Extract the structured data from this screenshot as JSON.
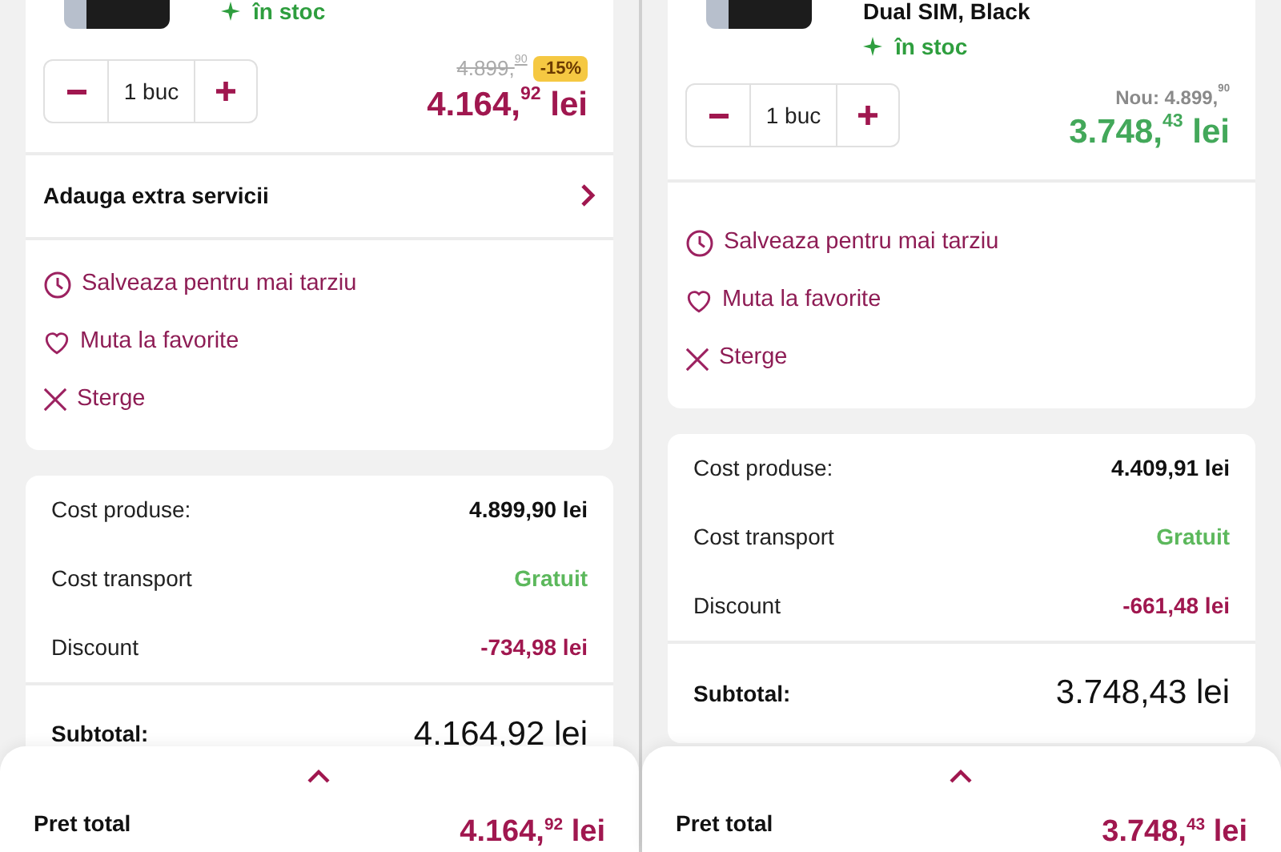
{
  "panels": [
    {
      "product": {
        "stock": "în stoc",
        "quantity": "1 buc",
        "reference_price": {
          "kind": "strikethrough",
          "text": "4.899,$^{90}$"
        },
        "badge": "-15%",
        "price": {
          "text": "4.164,$^{92}$ lei",
          "color": "#a0174f"
        }
      },
      "extra_services": "Adauga extra servicii",
      "actions": [
        {
          "kind": "clock",
          "label": "Salveaza pentru mai tarziu"
        },
        {
          "kind": "heart",
          "label": "Muta la favorite"
        },
        {
          "kind": "delete",
          "label": "Sterge"
        }
      ],
      "summary": {
        "rows": [
          {
            "label": "Cost produse:",
            "value": "4.899,90 lei",
            "kind": "default"
          },
          {
            "label": "Cost transport",
            "value": "Gratuit",
            "kind": "free"
          },
          {
            "label": "Discount",
            "value": "-734,98 lei",
            "kind": "discount"
          }
        ],
        "subtotal_label": "Subtotal:",
        "subtotal_value": "4.164,92 lei"
      },
      "footer": {
        "label": "Pret total",
        "price": "4.164,$^{92}$ lei"
      }
    },
    {
      "product": {
        "title": "Dual SIM, Black",
        "stock": "în stoc",
        "quantity": "1 buc",
        "reference_price": {
          "kind": "plain",
          "text": "Nou: 4.899,$^{90}$"
        },
        "price": {
          "text": "3.748,$^{43}$ lei",
          "color": "#43a85a"
        }
      },
      "actions": [
        {
          "kind": "clock",
          "label": "Salveaza pentru mai tarziu"
        },
        {
          "kind": "heart",
          "label": "Muta la favorite"
        },
        {
          "kind": "delete",
          "label": "Sterge"
        }
      ],
      "summary": {
        "rows": [
          {
            "label": "Cost produse:",
            "value": "4.409,91 lei",
            "kind": "default"
          },
          {
            "label": "Cost transport",
            "value": "Gratuit",
            "kind": "free"
          },
          {
            "label": "Discount",
            "value": "-661,48 lei",
            "kind": "discount"
          }
        ],
        "subtotal_label": "Subtotal:",
        "subtotal_value": "3.748,43 lei"
      },
      "footer": {
        "label": "Pret total",
        "price": "3.748,$^{43}$ lei"
      }
    }
  ]
}
